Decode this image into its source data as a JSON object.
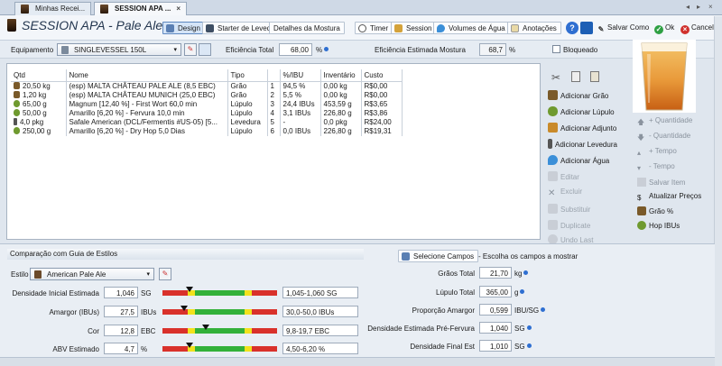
{
  "tabs": [
    {
      "label": "Minhas Recei...",
      "active": false
    },
    {
      "label": "SESSION APA ...",
      "active": true
    }
  ],
  "recipe_title": "SESSION APA - Pale Ale",
  "toolbar": {
    "design": "Design",
    "starter": "Starter de Levedura",
    "mash": "Detalhes da Mostura",
    "timer": "Timer",
    "session": "Session",
    "water": "Volumes de Água",
    "notes": "Anotações",
    "save_as": "Salvar Como",
    "ok": "Ok",
    "cancel": "Cancelar"
  },
  "equipment": {
    "label": "Equipamento",
    "value": "SINGLEVESSEL 150L",
    "eff_total_label": "Eficiência Total",
    "eff_total_value": "68,00",
    "eff_total_unit": "%",
    "eff_mash_label": "Eficiência Estimada Mostura",
    "eff_mash_value": "68,7",
    "eff_mash_unit": "%",
    "locked_label": "Bloqueado"
  },
  "ingredients": {
    "columns": [
      "Qtd",
      "Nome",
      "Tipo",
      "",
      "%/IBU",
      "Inventário",
      "Custo"
    ],
    "rows": [
      {
        "qty": "20,50 kg",
        "name": "(esp) MALTA CHÂTEAU PALE ALE (8,5 EBC)",
        "type": "Grão",
        "n": "1",
        "pct": "94,5 %",
        "inv": "0,00 kg",
        "cost": "R$0,00",
        "icon": "grain"
      },
      {
        "qty": "1,20 kg",
        "name": "(esp) MALTA CHÂTEAU MUNICH (25,0 EBC)",
        "type": "Grão",
        "n": "2",
        "pct": "5,5 %",
        "inv": "0,00 kg",
        "cost": "R$0,00",
        "icon": "grain"
      },
      {
        "qty": "65,00 g",
        "name": "Magnum [12,40 %] - First Wort 60,0 min",
        "type": "Lúpulo",
        "n": "3",
        "pct": "24,4 IBUs",
        "inv": "453,59 g",
        "cost": "R$3,65",
        "icon": "hop"
      },
      {
        "qty": "50,00 g",
        "name": "Amarillo [6,20 %] - Fervura 10,0 min",
        "type": "Lúpulo",
        "n": "4",
        "pct": "3,1 IBUs",
        "inv": "226,80 g",
        "cost": "R$3,86",
        "icon": "hop"
      },
      {
        "qty": "4,0 pkg",
        "name": "Safale American  (DCL/Fermentis #US-05) [5...",
        "type": "Levedura",
        "n": "5",
        "pct": "-",
        "inv": "0,0 pkg",
        "cost": "R$24,00",
        "icon": "yeast"
      },
      {
        "qty": "250,00 g",
        "name": "Amarillo [6,20 %] - Dry Hop 5,0 Dias",
        "type": "Lúpulo",
        "n": "6",
        "pct": "0,0 IBUs",
        "inv": "226,80 g",
        "cost": "R$19,31",
        "icon": "hop"
      }
    ]
  },
  "actions": {
    "add_grain": "Adicionar Grão",
    "add_hop": "Adicionar Lúpulo",
    "add_adjunct": "Adicionar Adjunto",
    "add_yeast": "Adicionar Levedura",
    "add_water": "Adicionar Água",
    "edit": "Editar",
    "delete": "Excluir",
    "replace": "Substituir",
    "duplicate": "Duplicate",
    "undo": "Undo Last"
  },
  "side": {
    "qty_up": "+ Quantidade",
    "qty_down": "- Quantidade",
    "time_up": "+ Tempo",
    "time_down": "- Tempo",
    "save_item": "Salvar Item",
    "update_prices": "Atualizar Preços",
    "grain_pct": "Grão %",
    "hop_ibus": "Hop IBUs"
  },
  "style_guide": {
    "title": "Comparação com Guia de Estilos",
    "style_label": "Estilo",
    "style_value": "American Pale Ale",
    "rows": [
      {
        "label": "Densidade Inicial Estimada",
        "value": "1,046",
        "unit": "SG",
        "range": "1,045-1,060 SG",
        "marker": 0.24
      },
      {
        "label": "Amargor (IBUs)",
        "value": "27,5",
        "unit": "IBUs",
        "range": "30,0-50,0 IBUs",
        "marker": 0.19
      },
      {
        "label": "Cor",
        "value": "12,8",
        "unit": "EBC",
        "range": "9,8-19,7 EBC",
        "marker": 0.38
      },
      {
        "label": "ABV Estimado",
        "value": "4,7",
        "unit": "%",
        "range": "4,50-6,20 %",
        "marker": 0.24
      }
    ]
  },
  "fields": {
    "select_button": "Selecione Campos",
    "hint": "- Escolha os campos a mostrar",
    "rows": [
      {
        "label": "Grãos Total",
        "value": "21,70",
        "unit": "kg"
      },
      {
        "label": "Lúpulo Total",
        "value": "365,00",
        "unit": "g"
      },
      {
        "label": "Proporção Amargor",
        "value": "0,599",
        "unit": "IBU/SG"
      },
      {
        "label": "Densidade Estimada Pré-Fervura",
        "value": "1,040",
        "unit": "SG"
      },
      {
        "label": "Densidade Final Est",
        "value": "1,010",
        "unit": "SG"
      }
    ]
  },
  "colors": {
    "gauge_red": "#d9312b",
    "gauge_yellow": "#f2e21c",
    "gauge_green": "#33b13a"
  }
}
